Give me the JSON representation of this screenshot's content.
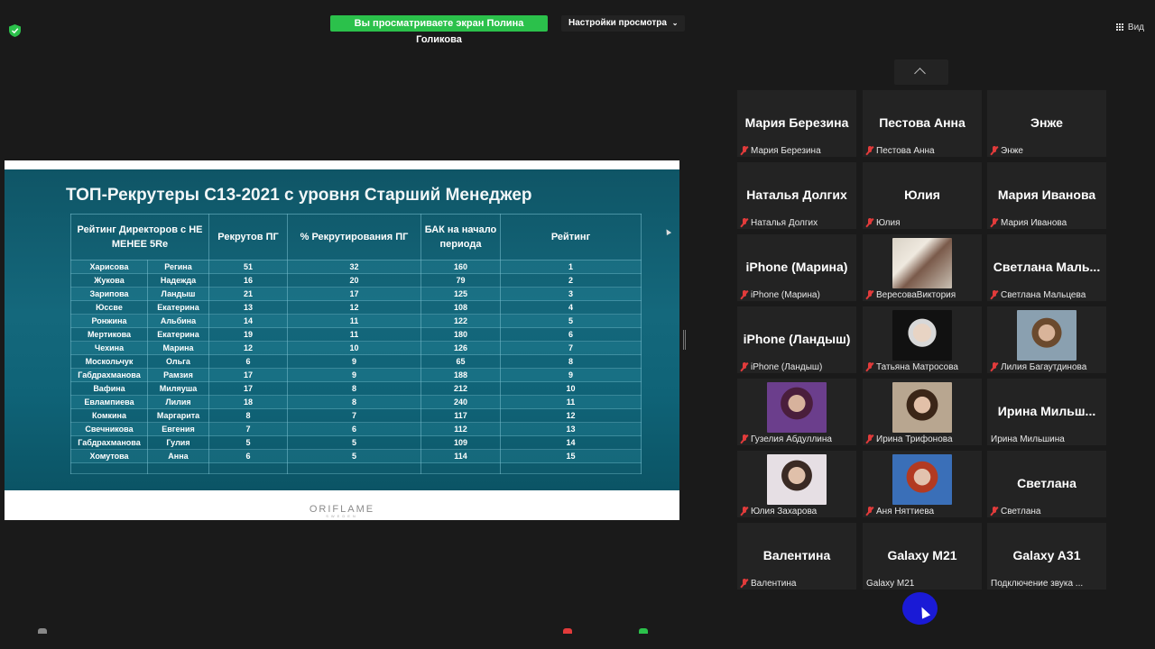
{
  "topbar": {
    "banner": "Вы просматриваете экран Полина Голикова",
    "view_settings": "Настройки просмотра",
    "view_button": "Вид"
  },
  "slide": {
    "title": "ТОП-Рекрутеры С13-2021 с уровня Старший Менеджер",
    "logo": "ORIFLAME",
    "logo_sub": "SWEDEN",
    "headers": {
      "rating_directors": "Рейтинг Директоров с НЕ МЕНЕЕ 5Re",
      "recruits_pg": "Рекрутов ПГ",
      "percent_recruiting": "% Рекрутирования ПГ",
      "bak_start": "БАК на начало периода",
      "rating": "Рейтинг"
    },
    "rows": [
      {
        "last": "Харисова",
        "first": "Регина",
        "recruits": "51",
        "percent": "32",
        "bak": "160",
        "rank": "1"
      },
      {
        "last": "Жукова",
        "first": "Надежда",
        "recruits": "16",
        "percent": "20",
        "bak": "79",
        "rank": "2"
      },
      {
        "last": "Зарипова",
        "first": "Ландыш",
        "recruits": "21",
        "percent": "17",
        "bak": "125",
        "rank": "3"
      },
      {
        "last": "Юссве",
        "first": "Екатерина",
        "recruits": "13",
        "percent": "12",
        "bak": "108",
        "rank": "4"
      },
      {
        "last": "Ронжина",
        "first": "Альбина",
        "recruits": "14",
        "percent": "11",
        "bak": "122",
        "rank": "5"
      },
      {
        "last": "Мертикова",
        "first": "Екатерина",
        "recruits": "19",
        "percent": "11",
        "bak": "180",
        "rank": "6"
      },
      {
        "last": "Чехина",
        "first": "Марина",
        "recruits": "12",
        "percent": "10",
        "bak": "126",
        "rank": "7"
      },
      {
        "last": "Москольчук",
        "first": "Ольга",
        "recruits": "6",
        "percent": "9",
        "bak": "65",
        "rank": "8"
      },
      {
        "last": "Габдрахманова",
        "first": "Рамзия",
        "recruits": "17",
        "percent": "9",
        "bak": "188",
        "rank": "9"
      },
      {
        "last": "Вафина",
        "first": "Миляуша",
        "recruits": "17",
        "percent": "8",
        "bak": "212",
        "rank": "10"
      },
      {
        "last": "Евлампиева",
        "first": "Лилия",
        "recruits": "18",
        "percent": "8",
        "bak": "240",
        "rank": "11"
      },
      {
        "last": "Комкина",
        "first": "Маргарита",
        "recruits": "8",
        "percent": "7",
        "bak": "117",
        "rank": "12"
      },
      {
        "last": "Свечникова",
        "first": "Евгения",
        "recruits": "7",
        "percent": "6",
        "bak": "112",
        "rank": "13"
      },
      {
        "last": "Габдрахманова",
        "first": "Гулия",
        "recruits": "5",
        "percent": "5",
        "bak": "109",
        "rank": "14"
      },
      {
        "last": "Хомутова",
        "first": "Анна",
        "recruits": "6",
        "percent": "5",
        "bak": "114",
        "rank": "15"
      }
    ]
  },
  "participants": [
    {
      "big": "Мария Березина",
      "label": "Мария Березина",
      "muted": true
    },
    {
      "big": "Пестова Анна",
      "label": "Пестова Анна",
      "muted": true
    },
    {
      "big": "Энже",
      "label": "Энже",
      "muted": true
    },
    {
      "big": "Наталья Долгих",
      "label": "Наталья Долгих",
      "muted": true
    },
    {
      "big": "Юлия",
      "label": "Юлия",
      "muted": true
    },
    {
      "big": "Мария Иванова",
      "label": "Мария Иванова",
      "muted": true
    },
    {
      "big": "iPhone (Марина)",
      "label": "iPhone (Марина)",
      "muted": true
    },
    {
      "big": "",
      "label": "ВересоваВиктория",
      "muted": true,
      "photo": "ph1"
    },
    {
      "big": "Светлана Маль...",
      "label": "Светлана Мальцева",
      "muted": true
    },
    {
      "big": "iPhone (Ландыш)",
      "label": "iPhone (Ландыш)",
      "muted": true
    },
    {
      "big": "",
      "label": "Татьяна Матросова",
      "muted": true,
      "photo": "ph2"
    },
    {
      "big": "",
      "label": "Лилия Багаутдинова",
      "muted": true,
      "photo": "ph3"
    },
    {
      "big": "",
      "label": "Гузелия Абдуллина",
      "muted": true,
      "photo": "ph4"
    },
    {
      "big": "",
      "label": "Ирина Трифонова",
      "muted": true,
      "photo": "ph5"
    },
    {
      "big": "Ирина Мильш...",
      "label": "Ирина Мильшина",
      "muted": false
    },
    {
      "big": "",
      "label": "Юлия Захарова",
      "muted": true,
      "photo": "ph6"
    },
    {
      "big": "",
      "label": "Аня Няттиева",
      "muted": true,
      "photo": "ph7"
    },
    {
      "big": "Светлана",
      "label": "Светлана",
      "muted": true
    },
    {
      "big": "Валентина",
      "label": "Валентина",
      "muted": true
    },
    {
      "big": "Galaxy M21",
      "label": "Galaxy M21",
      "muted": false
    },
    {
      "big": "Galaxy A31",
      "label": "Подключение звука ...",
      "muted": false
    }
  ],
  "colors": {
    "banner_green": "#2bc14b",
    "slide_teal": "#14687c",
    "tile_bg": "#232323",
    "cursor_blue": "#1a1ad6",
    "muted_red": "#e23b3b"
  }
}
